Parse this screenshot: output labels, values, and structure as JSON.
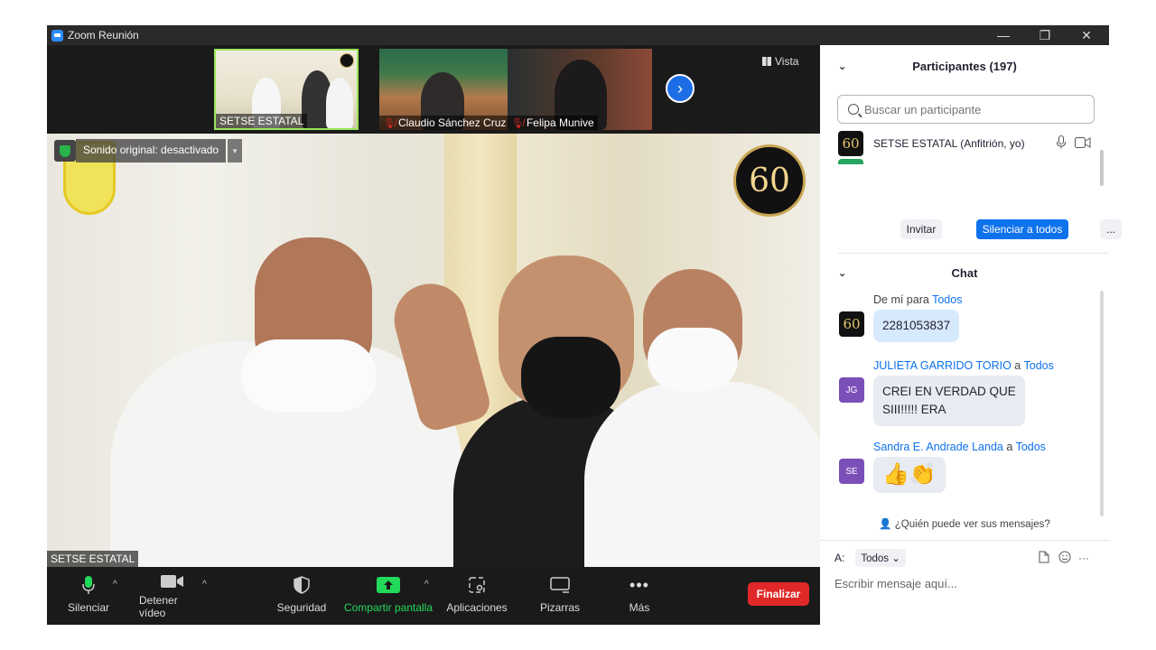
{
  "window": {
    "title": "Zoom Reunión"
  },
  "gallery": {
    "thumbnails": [
      {
        "name": "SETSE ESTATAL",
        "muted": false
      },
      {
        "name": "Claudio Sánchez Cruz",
        "muted": true
      },
      {
        "name": "Felipa Munive",
        "muted": true
      }
    ],
    "view_label": "Vista"
  },
  "main_video": {
    "speaker_name": "SETSE ESTATAL",
    "audio_banner": "Sonido original: desactivado",
    "anniversary_text": "60"
  },
  "toolbar": {
    "mute": "Silenciar",
    "stop_video": "Detener vídeo",
    "security": "Seguridad",
    "share_screen": "Compartir pantalla",
    "apps": "Aplicaciones",
    "whiteboards": "Pizarras",
    "more": "Más",
    "end": "Finalizar"
  },
  "colors": {
    "accent": "#0e72ed",
    "share": "#23d959",
    "end": "#e02828",
    "active_speaker": "#9be45a"
  },
  "participants": {
    "title": "Participantes (197)",
    "search_placeholder": "Buscar un participante",
    "list": [
      {
        "name": "SETSE ESTATAL (Anfitrión, yo)",
        "avatar": "60"
      }
    ],
    "invite_label": "Invitar",
    "mute_all_label": "Silenciar a todos",
    "more_label": "..."
  },
  "chat": {
    "title": "Chat",
    "messages": [
      {
        "from": "De mí para",
        "to": "Todos",
        "sender_link": false,
        "avatar": "60",
        "text": "2281053837"
      },
      {
        "from": "JULIETA GARRIDO TORIO",
        "connector": "a",
        "to": "Todos",
        "avatar": "JG",
        "text_line1": "CREI EN VERDAD QUE",
        "text_line2": "SIII!!!!! ERA"
      },
      {
        "from": "Sandra E. Andrade Landa",
        "connector": "a",
        "to": "Todos",
        "avatar": "SE",
        "text": "👍👏"
      }
    ],
    "who_can_see": "¿Quién puede ver sus mensajes?",
    "to_label": "A:",
    "to_value": "Todos",
    "input_placeholder": "Escribir mensaje aquí...",
    "more_label": "···"
  }
}
